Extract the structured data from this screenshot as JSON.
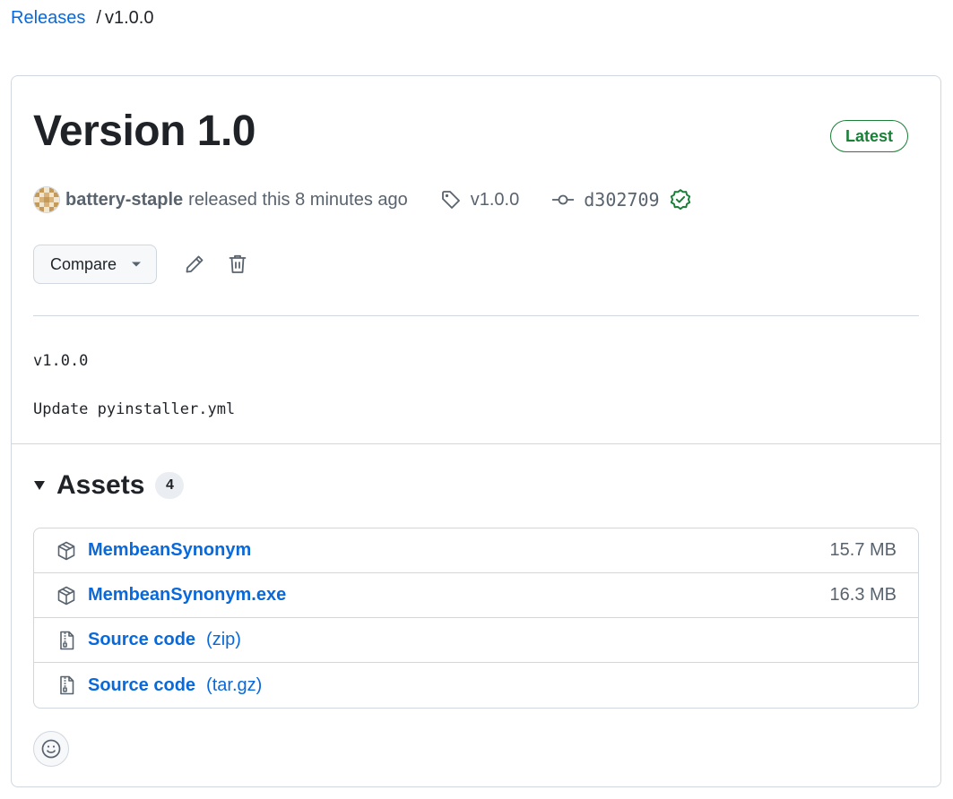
{
  "breadcrumb": {
    "releases_label": "Releases",
    "separator": "/",
    "current": "v1.0.0"
  },
  "release": {
    "title": "Version 1.0",
    "latest_badge": "Latest",
    "author": "battery-staple",
    "released_text": "released this 8 minutes ago",
    "tag": "v1.0.0",
    "commit": "d302709",
    "commit_verified": true,
    "compare_label": "Compare"
  },
  "notes": {
    "line1": "v1.0.0",
    "line2": "Update pyinstaller.yml"
  },
  "assets": {
    "heading": "Assets",
    "count": "4",
    "items": [
      {
        "icon": "package-icon",
        "name": "MembeanSynonym",
        "ext": "",
        "size": "15.7 MB"
      },
      {
        "icon": "package-icon",
        "name": "MembeanSynonym.exe",
        "ext": "",
        "size": "16.3 MB"
      },
      {
        "icon": "file-zip-icon",
        "name": "Source code",
        "ext": "(zip)",
        "size": ""
      },
      {
        "icon": "file-zip-icon",
        "name": "Source code",
        "ext": "(tar.gz)",
        "size": ""
      }
    ]
  },
  "colors": {
    "link": "#0969da",
    "success": "#1a7f37",
    "border": "#d0d7de",
    "muted": "#59636e"
  }
}
